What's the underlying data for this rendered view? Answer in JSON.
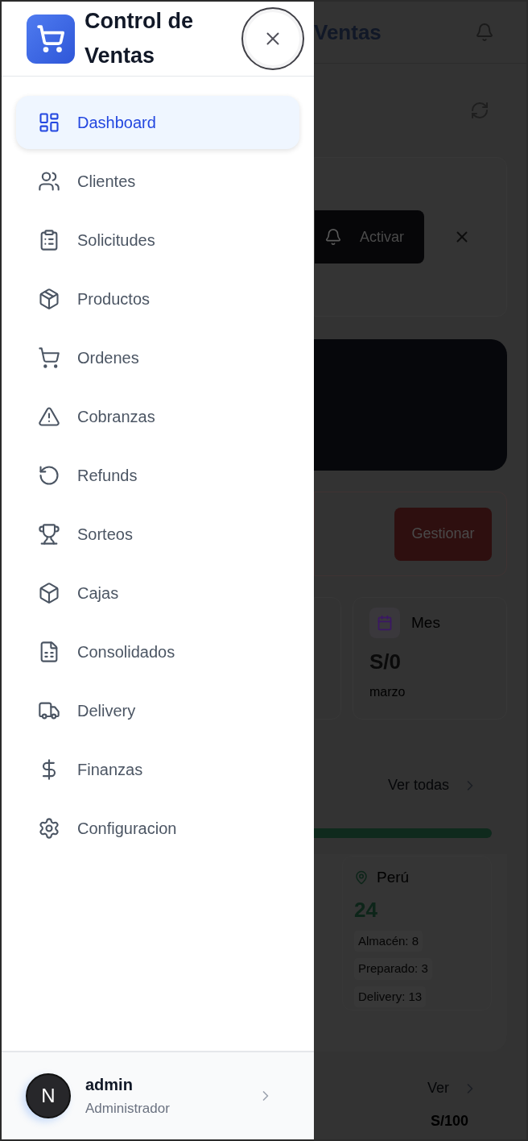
{
  "drawer": {
    "title": "Control de Ventas",
    "nav": [
      {
        "label": "Dashboard",
        "selected": true
      },
      {
        "label": "Clientes",
        "selected": false
      },
      {
        "label": "Solicitudes",
        "selected": false
      },
      {
        "label": "Productos",
        "selected": false
      },
      {
        "label": "Ordenes",
        "selected": false
      },
      {
        "label": "Cobranzas",
        "selected": false
      },
      {
        "label": "Refunds",
        "selected": false
      },
      {
        "label": "Sorteos",
        "selected": false
      },
      {
        "label": "Cajas",
        "selected": false
      },
      {
        "label": "Consolidados",
        "selected": false
      },
      {
        "label": "Delivery",
        "selected": false
      },
      {
        "label": "Finanzas",
        "selected": false
      },
      {
        "label": "Configuracion",
        "selected": false
      }
    ],
    "user": {
      "avatar": "N",
      "name": "admin",
      "role": "Administrador"
    }
  },
  "background": {
    "header_title": "Ventas",
    "notice_button": "Activar",
    "alert_button": "Gestionar",
    "stat_card": {
      "label": "Mes",
      "value": "S/0",
      "caption": "marzo"
    },
    "link_all": "Ver todas",
    "progress": {
      "level": 1
    },
    "region_card": {
      "name": "Perú",
      "total": "24",
      "lines": [
        "Almacén: 8",
        "Preparado: 3",
        "Delivery: 13"
      ]
    },
    "link_more": "Ver",
    "amount": "S/100"
  }
}
